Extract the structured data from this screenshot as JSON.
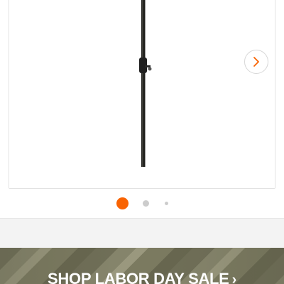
{
  "carousel": {
    "image_alt": "Black patio umbrella pole with crank handle",
    "next_icon": "chevron-right-icon",
    "active_dot_color": "#f96302",
    "inactive_dot_color": "#cccccc",
    "slide_count": 3,
    "active_slide": 1
  },
  "promo": {
    "label": "SHOP LABOR DAY SALE",
    "chevron": "›",
    "icon": "chevron-right-icon"
  }
}
